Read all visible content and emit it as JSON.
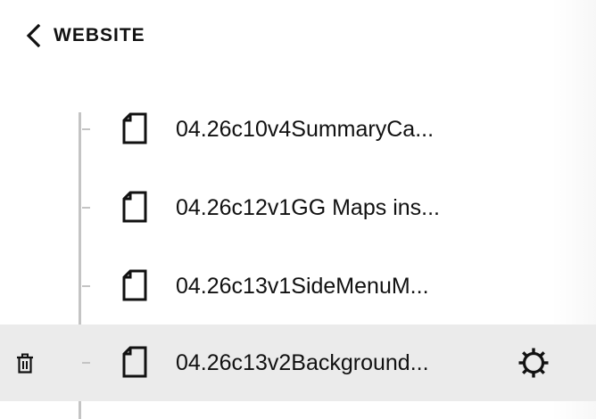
{
  "header": {
    "back_label": "WEBSITE",
    "back_icon": "chevron-left-icon"
  },
  "pages": [
    {
      "title": "04.26c10v4SummaryCa...",
      "icon": "page-icon",
      "selected": false
    },
    {
      "title": "04.26c12v1GG Maps ins...",
      "icon": "page-icon",
      "selected": false
    },
    {
      "title": "04.26c13v1SideMenuM...",
      "icon": "page-icon",
      "selected": false
    },
    {
      "title": "04.26c13v2Background...",
      "icon": "page-icon",
      "selected": true,
      "actions": [
        "trash-icon",
        "gear-icon"
      ]
    }
  ]
}
